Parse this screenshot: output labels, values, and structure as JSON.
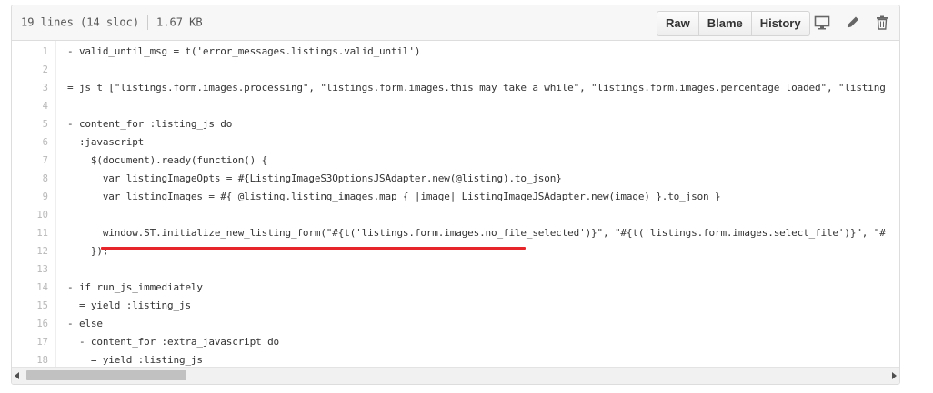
{
  "file_info": {
    "lines": "19 lines (14 sloc)",
    "size": "1.67 KB"
  },
  "toolbar": {
    "raw_label": "Raw",
    "blame_label": "Blame",
    "history_label": "History"
  },
  "icons": [
    "desktop-icon",
    "pencil-icon",
    "trash-icon"
  ],
  "colors": {
    "accent_underline": "#e5252a",
    "keyword": "#a71d5d",
    "string": "#183691"
  },
  "code_lines": [
    {
      "num": "1",
      "text": "- valid_until_msg = t('error_messages.listings.valid_until')"
    },
    {
      "num": "2",
      "text": ""
    },
    {
      "num": "3",
      "text": "= js_t [\"listings.form.images.processing\", \"listings.form.images.this_may_take_a_while\", \"listings.form.images.percentage_loaded\", \"listing"
    },
    {
      "num": "4",
      "text": ""
    },
    {
      "num": "5",
      "text": "- content_for :listing_js do"
    },
    {
      "num": "6",
      "text": "  :javascript"
    },
    {
      "num": "7",
      "text": "    $(document).ready(function() {"
    },
    {
      "num": "8",
      "text": "      var listingImageOpts = #{ListingImageS3OptionsJSAdapter.new(@listing).to_json}"
    },
    {
      "num": "9",
      "text": "      var listingImages = #{ @listing.listing_images.map { |image| ListingImageJSAdapter.new(image) }.to_json }"
    },
    {
      "num": "10",
      "text": ""
    },
    {
      "num": "11",
      "text": "      window.ST.initialize_new_listing_form(\"#{t('listings.form.images.no_file_selected')}\", \"#{t('listings.form.images.select_file')}\", \"#"
    },
    {
      "num": "12",
      "text": "    });"
    },
    {
      "num": "13",
      "text": ""
    },
    {
      "num": "14",
      "text": "- if run_js_immediately"
    },
    {
      "num": "15",
      "text": "  = yield :listing_js"
    },
    {
      "num": "16",
      "text": "- else"
    },
    {
      "num": "17",
      "text": "  - content_for :extra_javascript do"
    },
    {
      "num": "18",
      "text": "    = yield :listing_js"
    }
  ]
}
